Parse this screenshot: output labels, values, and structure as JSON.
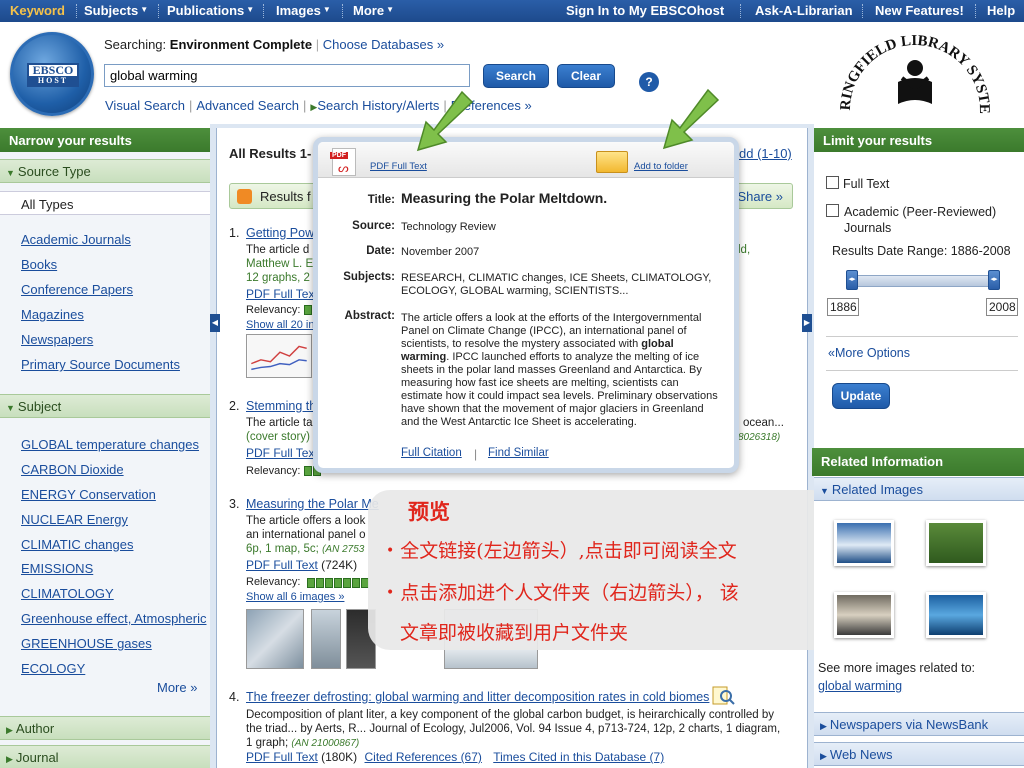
{
  "topnav": {
    "keyword": "Keyword",
    "subjects": "Subjects",
    "publications": "Publications",
    "images": "Images",
    "more": "More",
    "sign_in": "Sign In to My EBSCOhost",
    "ask_librarian": "Ask-A-Librarian",
    "new_features": "New Features!",
    "help": "Help"
  },
  "header": {
    "logo_text": "EBSCO",
    "logo_sub": "HOST",
    "searching_label": "Searching:",
    "database": "Environment Complete",
    "choose_db": "Choose Databases »",
    "search_value": "global warming",
    "search_btn": "Search",
    "clear_btn": "Clear",
    "help_icon": "?",
    "visual_search": "Visual Search",
    "advanced_search": "Advanced Search",
    "history": "Search History/Alerts",
    "preferences": "Preferences »",
    "library_name": "SPRINGFIELD LIBRARY SYSTEM"
  },
  "left": {
    "title": "Narrow your results",
    "source_type": "Source Type",
    "all_types": "All Types",
    "source_items": [
      "Academic Journals",
      "Books",
      "Conference Papers",
      "Magazines",
      "Newspapers",
      "Primary Source Documents"
    ],
    "subject": "Subject",
    "subject_items": [
      "GLOBAL temperature changes",
      "CARBON Dioxide",
      "ENERGY Conservation",
      "NUCLEAR Energy",
      "CLIMATIC changes",
      "EMISSIONS",
      "CLIMATOLOGY",
      "Greenhouse effect, Atmospheric",
      "GREENHOUSE gases",
      "ECOLOGY"
    ],
    "more": "More »",
    "author": "Author",
    "journal": "Journal"
  },
  "center": {
    "all_results": "All Results 1-",
    "add": "dd (1-10)",
    "results_bar": "Results f",
    "share": "Share »",
    "r1": {
      "num": "1.",
      "title": "Getting Pow",
      "line1": "The article d",
      "line1b": "ld,",
      "line2": "Matthew L. E",
      "line3": "12 graphs, 2",
      "pdf": "PDF Full Tex",
      "relevancy": "Relevancy:",
      "show_all": "Show all 20 in"
    },
    "r2": {
      "num": "2.",
      "title": "Stemming th",
      "line1": "The article ta",
      "line1b": "ocean...",
      "line2": "(cover story)",
      "an": "8026318)",
      "pdf": "PDF Full Text",
      "relevancy": "Relevancy:"
    },
    "r3": {
      "num": "3.",
      "title": "Measuring the Polar Me",
      "line1": "The article offers a look",
      "line2": "an international panel o",
      "line3": "6p, 1 map, 5c;",
      "an": "(AN 2753",
      "pdf": "PDF Full Text",
      "size": "(724K)",
      "relevancy": "Relevancy:",
      "show_all": "Show all 6 images »"
    },
    "r4": {
      "num": "4.",
      "title": "The freezer defrosting: global warming and litter decomposition rates in cold biomes",
      "line1": "Decomposition of plant liter, a key component of the global carbon budget, is heirarchically controlled by",
      "line2": "the triad... by Aerts, R... Journal of Ecology, Jul2006, Vol. 94 Issue 4, p713-724, 12p, 2 charts, 1 diagram,",
      "line3": "1 graph;",
      "an": "(AN 21000867)",
      "pdf": "PDF Full Text",
      "size": "(180K)",
      "cited": "Cited References (67)",
      "times": "Times Cited in this Database (7)"
    }
  },
  "popup": {
    "pdf_link": "PDF Full Text",
    "add_folder": "Add to folder",
    "title_label": "Title:",
    "title": "Measuring the Polar Meltdown.",
    "source_label": "Source:",
    "source": "Technology Review",
    "date_label": "Date:",
    "date": "November 2007",
    "subjects_label": "Subjects:",
    "subjects1": "RESEARCH, CLIMATIC changes, ICE Sheets, CLIMATOLOGY,",
    "subjects2": "ECOLOGY, GLOBAL warming, SCIENTISTS...",
    "abstract_label": "Abstract:",
    "abstract_a": "The article offers a look at the efforts of the Intergovernmental Panel on Climate Change (IPCC), an international panel of scientists, to resolve the mystery associated with",
    "abstract_bold": "global warming",
    "abstract_b": ". IPCC launched efforts to analyze the melting of ice sheets in the polar land masses Greenland and Antarctica. By measuring how fast ice sheets are melting, scientists can estimate how it could impact sea levels. Preliminary observations have shown that the movement of major glaciers in Greenland and the West Antarctic Ice Sheet is accelerating.",
    "full_citation": "Full Citation",
    "find_similar": "Find Similar"
  },
  "overlay": {
    "title": "预览",
    "line1": "全文链接(左边箭头）,点击即可阅读全文",
    "line2": "点击添加进个人文件夹（右边箭头）， 该",
    "line3": "文章即被收藏到用户文件夹"
  },
  "right": {
    "title": "Limit your results",
    "full_text": "Full Text",
    "academic1": "Academic (Peer-Reviewed)",
    "academic2": "Journals",
    "date_range": "Results Date Range: 1886-2008",
    "year_from": "1886",
    "year_to": "2008",
    "more_options": "«More Options",
    "update": "Update",
    "related_info": "Related Information",
    "related_images": "Related Images",
    "see_more": "See more images related to:",
    "see_more_link": "global warming",
    "newspapers": "Newspapers via NewsBank",
    "web_news": "Web News"
  }
}
